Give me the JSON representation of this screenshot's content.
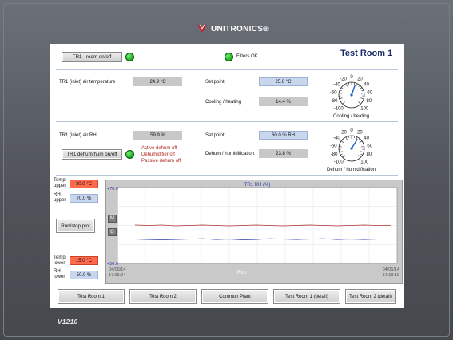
{
  "brand": {
    "name": "UNITRONICS®",
    "model": "V1210"
  },
  "header": {
    "room_button": "TR1 - room on/off",
    "filters_status": "Filters OK",
    "room_title": "Test Room 1"
  },
  "temperature": {
    "inlet_label": "TR1 (inlet) air temperature",
    "inlet_value": "24.9 °C",
    "setpoint_label": "Set point",
    "setpoint_value": "25.0 °C",
    "control_label": "Cooling / heating",
    "control_value": "14.4 %",
    "gauge": {
      "caption": "Cooling / heating",
      "ticks": [
        "-20",
        "0",
        "20",
        "-40",
        "40",
        "-60",
        "60",
        "-80",
        "80",
        "-100",
        "100"
      ],
      "value": 14.4
    }
  },
  "humidity": {
    "inlet_label": "TR1 (inlet) air RH",
    "inlet_value": "59.9 %",
    "button": "TR1 dehum/hum on/off",
    "alarms": [
      "Active dehum off",
      "Dehumidifier off",
      "Passive dehum off"
    ],
    "setpoint_label": "Set point",
    "setpoint_value": "60.0 % RH",
    "control_label": "Dehum / humidification",
    "control_value": "23.8 %",
    "gauge": {
      "caption": "Dehum / humidification",
      "ticks": [
        "-20",
        "0",
        "20",
        "-40",
        "40",
        "-60",
        "60",
        "-80",
        "80",
        "-100",
        "100"
      ],
      "value": 23.8
    }
  },
  "limits": {
    "temp_upper_label": "Temp upper",
    "temp_upper_value": "30.0 °C",
    "rh_upper_label": "RH upper",
    "rh_upper_value": "70.0 %",
    "run_stop": "Run/stop plot",
    "temp_lower_label": "Temp lower",
    "temp_lower_value": "15.0 °C",
    "rh_lower_label": "RH lower",
    "rh_lower_value": "50.0 %"
  },
  "trend": {
    "title": "TR1 RH (%)",
    "y_max_label": "+70.0",
    "y_min_label": "+50.0",
    "status": "Run",
    "start_date": "04/06/14",
    "start_time": "17:05:24",
    "end_date": "04/06/14",
    "end_time": "17:18:19",
    "side_buttons": [
      "M",
      "G"
    ]
  },
  "chart_data": {
    "type": "line",
    "title": "TR1 RH (%)",
    "ylim": [
      50,
      70
    ],
    "x": [
      "17:05:24",
      "17:18:19"
    ],
    "series": [
      {
        "values": [
          60.1,
          60.0,
          60.1,
          59.9,
          60.0,
          60.1,
          60.0,
          59.9,
          60.0,
          60.1,
          60.0,
          59.9,
          60.0,
          60.1,
          60.0,
          59.9,
          60.0,
          60.1,
          60.0,
          60.0
        ]
      },
      {
        "values": [
          56.4,
          56.3,
          56.2,
          56.3,
          56.4,
          56.5,
          56.3,
          56.4,
          56.2,
          56.3,
          56.5,
          56.4,
          56.3,
          56.4,
          56.5,
          56.3,
          56.4,
          56.3,
          56.4,
          56.4
        ]
      }
    ]
  },
  "nav": [
    "Test Room 1",
    "Test Room 2",
    "Common Plant",
    "Test Room 1 (detail)",
    "Test Room 2 (detail)"
  ],
  "colors": {
    "title": "#1a2a66",
    "alarm": "#b3261e",
    "setpoint": "#c9d7ee",
    "limit_temp": "#ff6a4d",
    "series_upper": "#b03030",
    "series_lower": "#2a3aa8"
  }
}
